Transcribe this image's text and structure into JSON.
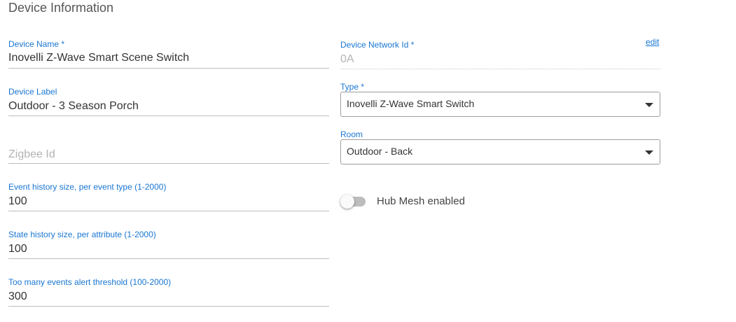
{
  "section_title": "Device Information",
  "left_fields": {
    "device_name": {
      "label": "Device Name *",
      "value": "Inovelli Z-Wave Smart Scene Switch"
    },
    "device_label": {
      "label": "Device Label",
      "value": "Outdoor - 3 Season Porch"
    },
    "zigbee_id": {
      "placeholder": "Zigbee Id"
    },
    "event_history": {
      "label": "Event history size, per event type (1-2000)",
      "value": "100"
    },
    "state_history": {
      "label": "State history size, per attribute (1-2000)",
      "value": "100"
    },
    "alert_threshold": {
      "label": "Too many events alert threshold (100-2000)",
      "value": "300"
    }
  },
  "right_fields": {
    "network_id": {
      "label": "Device Network Id *",
      "value": "0A",
      "edit_label": "edit"
    },
    "type": {
      "label": "Type *",
      "selected": "Inovelli Z-Wave Smart Switch"
    },
    "room": {
      "label": "Room",
      "selected": "Outdoor - Back"
    },
    "hub_mesh": {
      "label": "Hub Mesh enabled",
      "enabled": false
    }
  },
  "colors": {
    "accent": "#1976d2",
    "underline": "#bdbdbd",
    "placeholder": "#b3b3b3"
  },
  "icons": {
    "dropdown": "caret-down-icon"
  }
}
